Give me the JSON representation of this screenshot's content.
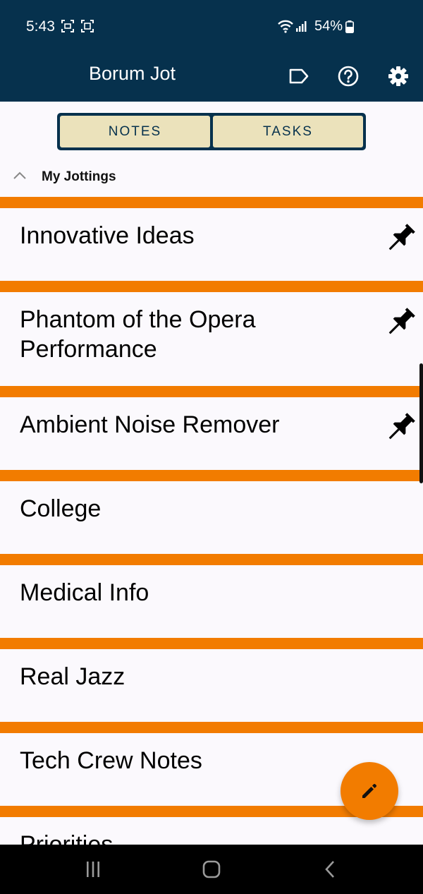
{
  "status_bar": {
    "time": "5:43",
    "battery": "54%",
    "icons": [
      "screenshot-icon",
      "screen-record-icon",
      "wifi-icon",
      "signal-icon",
      "battery-icon"
    ]
  },
  "app_bar": {
    "title": "Borum Jot",
    "actions": [
      "label-icon",
      "help-icon",
      "settings-icon"
    ]
  },
  "tabs": [
    {
      "label": "NOTES",
      "selected": true
    },
    {
      "label": "TASKS",
      "selected": false
    }
  ],
  "group": {
    "title": "My Jottings",
    "expanded": true
  },
  "notes": [
    {
      "title": "Innovative Ideas",
      "pinned": true
    },
    {
      "title": "Phantom of the Opera Performance",
      "pinned": true
    },
    {
      "title": "Ambient Noise Remover",
      "pinned": true
    },
    {
      "title": "College",
      "pinned": false
    },
    {
      "title": "Medical Info",
      "pinned": false
    },
    {
      "title": "Real Jazz",
      "pinned": false
    },
    {
      "title": "Tech Crew Notes",
      "pinned": false
    },
    {
      "title": "Priorities",
      "pinned": false
    }
  ],
  "fab": {
    "icon": "pencil-icon"
  },
  "nav_bar": {
    "buttons": [
      "recents-icon",
      "home-icon",
      "back-icon"
    ]
  },
  "colors": {
    "primary": "#06314d",
    "accent": "#f27c00",
    "tab_fill": "#ebe2bb",
    "background": "#fbf9fd"
  }
}
